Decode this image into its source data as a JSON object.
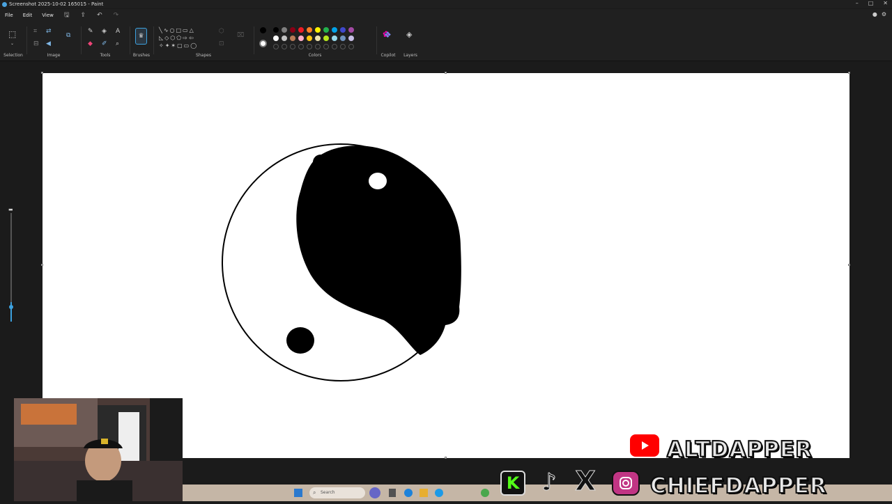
{
  "window": {
    "title": "Screenshot 2025-10-02 165015 - Paint",
    "controls": [
      "–",
      "□",
      "✕"
    ]
  },
  "menu": {
    "file": "File",
    "edit": "Edit",
    "view": "View"
  },
  "ribbon": {
    "groups": {
      "selection": "Selection",
      "image": "Image",
      "tools": "Tools",
      "brushes": "Brushes",
      "shapes": "Shapes",
      "colors": "Colors",
      "copilot": "Copilot",
      "layers": "Layers"
    },
    "palette_row1": [
      "#000000",
      "#7f7f7f",
      "#880015",
      "#ed1c24",
      "#ff7f27",
      "#fff200",
      "#22b14c",
      "#00a2e8",
      "#3f48cc",
      "#a349a4"
    ],
    "palette_row2": [
      "#ffffff",
      "#c3c3c3",
      "#b97a57",
      "#ffaec9",
      "#ffc90e",
      "#efe4b0",
      "#b5e61d",
      "#99d9ea",
      "#7092be",
      "#c8bfe7"
    ],
    "primary_color": "#000000",
    "secondary_color": "#ffffff"
  },
  "canvas": {
    "background": "#ffffff",
    "drawing_color": "#000000"
  },
  "brush_size_level": 0.15,
  "taskbar": {
    "search_placeholder": "Search"
  },
  "overlay": {
    "youtube_handle": "ALTDAPPER",
    "social_handle": "CHIEFDAPPER",
    "icons": [
      "youtube-icon",
      "kick-icon",
      "tiktok-icon",
      "x-icon",
      "instagram-icon"
    ]
  }
}
